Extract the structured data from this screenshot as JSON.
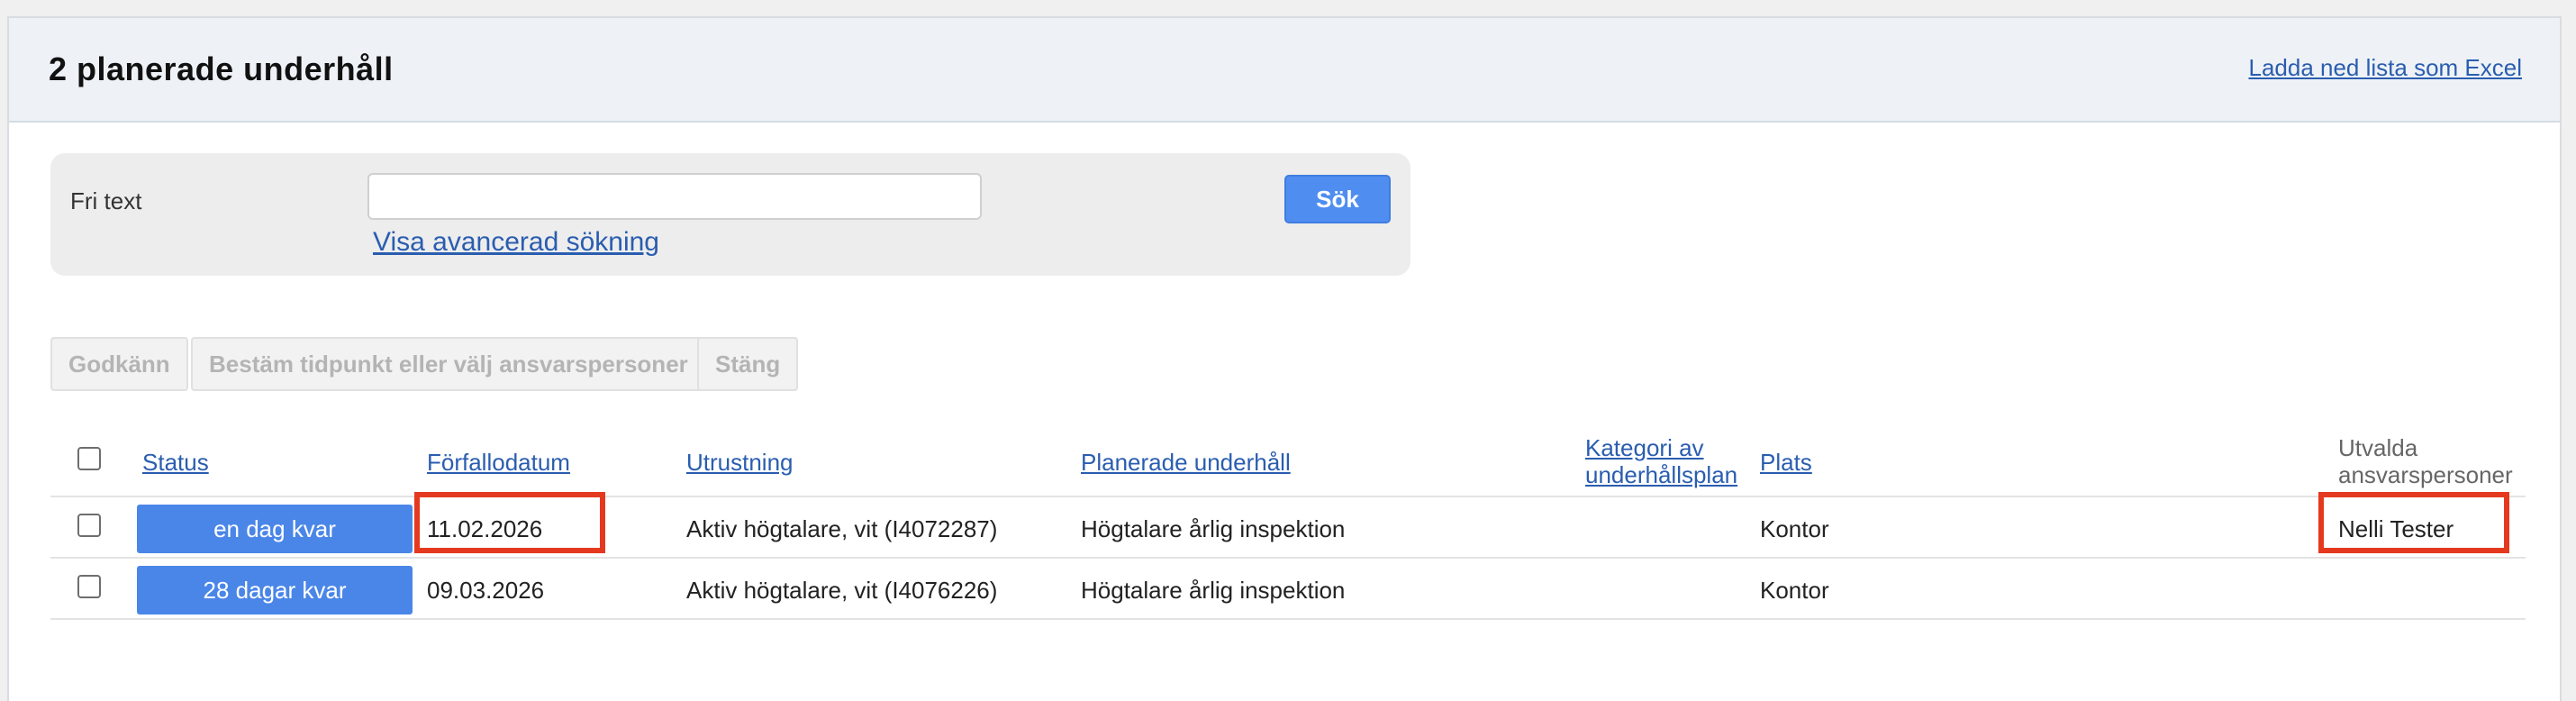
{
  "header": {
    "title": "2 planerade underhåll",
    "download_link": "Ladda ned lista som Excel"
  },
  "search": {
    "label": "Fri text",
    "value": "",
    "placeholder": "",
    "advanced_link": "Visa avancerad sökning",
    "button_label": "Sök"
  },
  "actions": {
    "approve": "Godkänn",
    "schedule": "Bestäm tidpunkt eller välj ansvarspersoner",
    "close": "Stäng"
  },
  "table": {
    "columns": {
      "status": "Status",
      "due_date": "Förfallodatum",
      "equipment": "Utrustning",
      "planned_maintenance": "Planerade underhåll",
      "category_line1": "Kategori av",
      "category_line2": "underhållsplan",
      "location": "Plats",
      "responsible_line1": "Utvalda",
      "responsible_line2": "ansvarspersoner"
    },
    "rows": [
      {
        "status": "en dag kvar",
        "due_date": "11.02.2026",
        "equipment": "Aktiv högtalare, vit (I4072287)",
        "planned_maintenance": "Högtalare årlig inspektion",
        "category": "",
        "location": "Kontor",
        "responsible": "Nelli Tester"
      },
      {
        "status": "28 dagar kvar",
        "due_date": "09.03.2026",
        "equipment": "Aktiv högtalare, vit (I4076226)",
        "planned_maintenance": "Högtalare årlig inspektion",
        "category": "",
        "location": "Kontor",
        "responsible": ""
      }
    ]
  },
  "colors": {
    "accent": "#4a86e8",
    "link": "#2a5db0",
    "highlight": "#e5391f",
    "header_bg": "#eef2f6"
  }
}
